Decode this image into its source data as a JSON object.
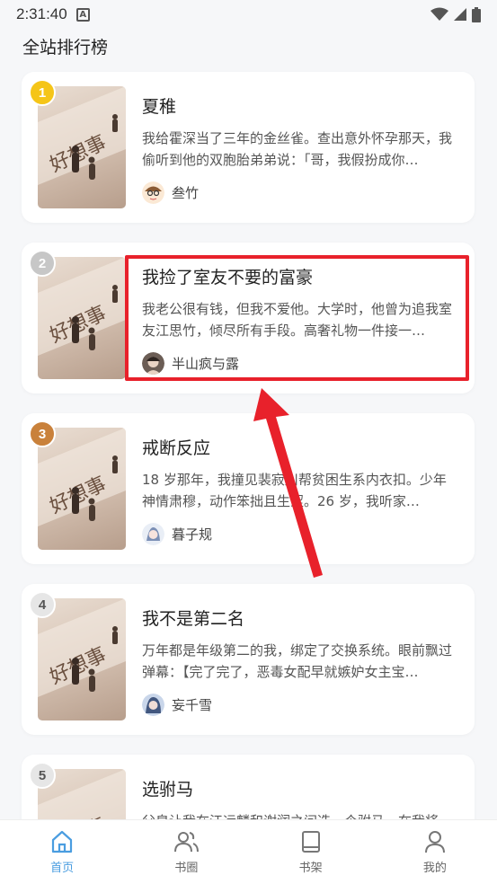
{
  "status_bar": {
    "time": "2:31:40",
    "notification_glyph": "A"
  },
  "page_title": "全站排行榜",
  "ranking": [
    {
      "rank": "1",
      "rank_color": "#f5c518",
      "title": "夏稚",
      "desc": "我给霍深当了三年的金丝雀。查出意外怀孕那天，我偷听到他的双胞胎弟弟说：「哥，我假扮成你…",
      "author": "叁竹",
      "avatar_icon": "cartoon-avatar-icon"
    },
    {
      "rank": "2",
      "rank_color": "#c7c7c7",
      "title": "我捡了室友不要的富豪",
      "desc": "我老公很有钱，但我不爱他。大学时，他曾为追我室友江思竹，倾尽所有手段。高奢礼物一件接一…",
      "author": "半山疯与露",
      "avatar_icon": "portrait-avatar-icon"
    },
    {
      "rank": "3",
      "rank_color": "#c9813b",
      "title": "戒断反应",
      "desc": "18 岁那年，我撞见裴寂川帮贫困生系内衣扣。少年神情肃穆，动作笨拙且生涩。26 岁，我听家…",
      "author": "暮子规",
      "avatar_icon": "anime-avatar-icon"
    },
    {
      "rank": "4",
      "rank_color": "#e6e6e6",
      "title": "我不是第二名",
      "desc": "万年都是年级第二的我，绑定了交换系统。眼前飘过弹幕：【完了完了，恶毒女配早就嫉妒女主宝…",
      "author": "妄千雪",
      "avatar_icon": "anime-avatar-icon"
    },
    {
      "rank": "5",
      "rank_color": "#e6e6e6",
      "title": "选驸马",
      "desc": "父皇让我在江远麟和谢润之间选一个驸马，在我将…",
      "author": "",
      "avatar_icon": ""
    }
  ],
  "bottom_nav": [
    {
      "label": "首页",
      "icon": "home-icon",
      "active": true
    },
    {
      "label": "书圈",
      "icon": "users-icon",
      "active": false
    },
    {
      "label": "书架",
      "icon": "book-icon",
      "active": false
    },
    {
      "label": "我的",
      "icon": "user-icon",
      "active": false
    }
  ],
  "colors": {
    "accent": "#4a9de0",
    "highlight": "#e8212b"
  }
}
